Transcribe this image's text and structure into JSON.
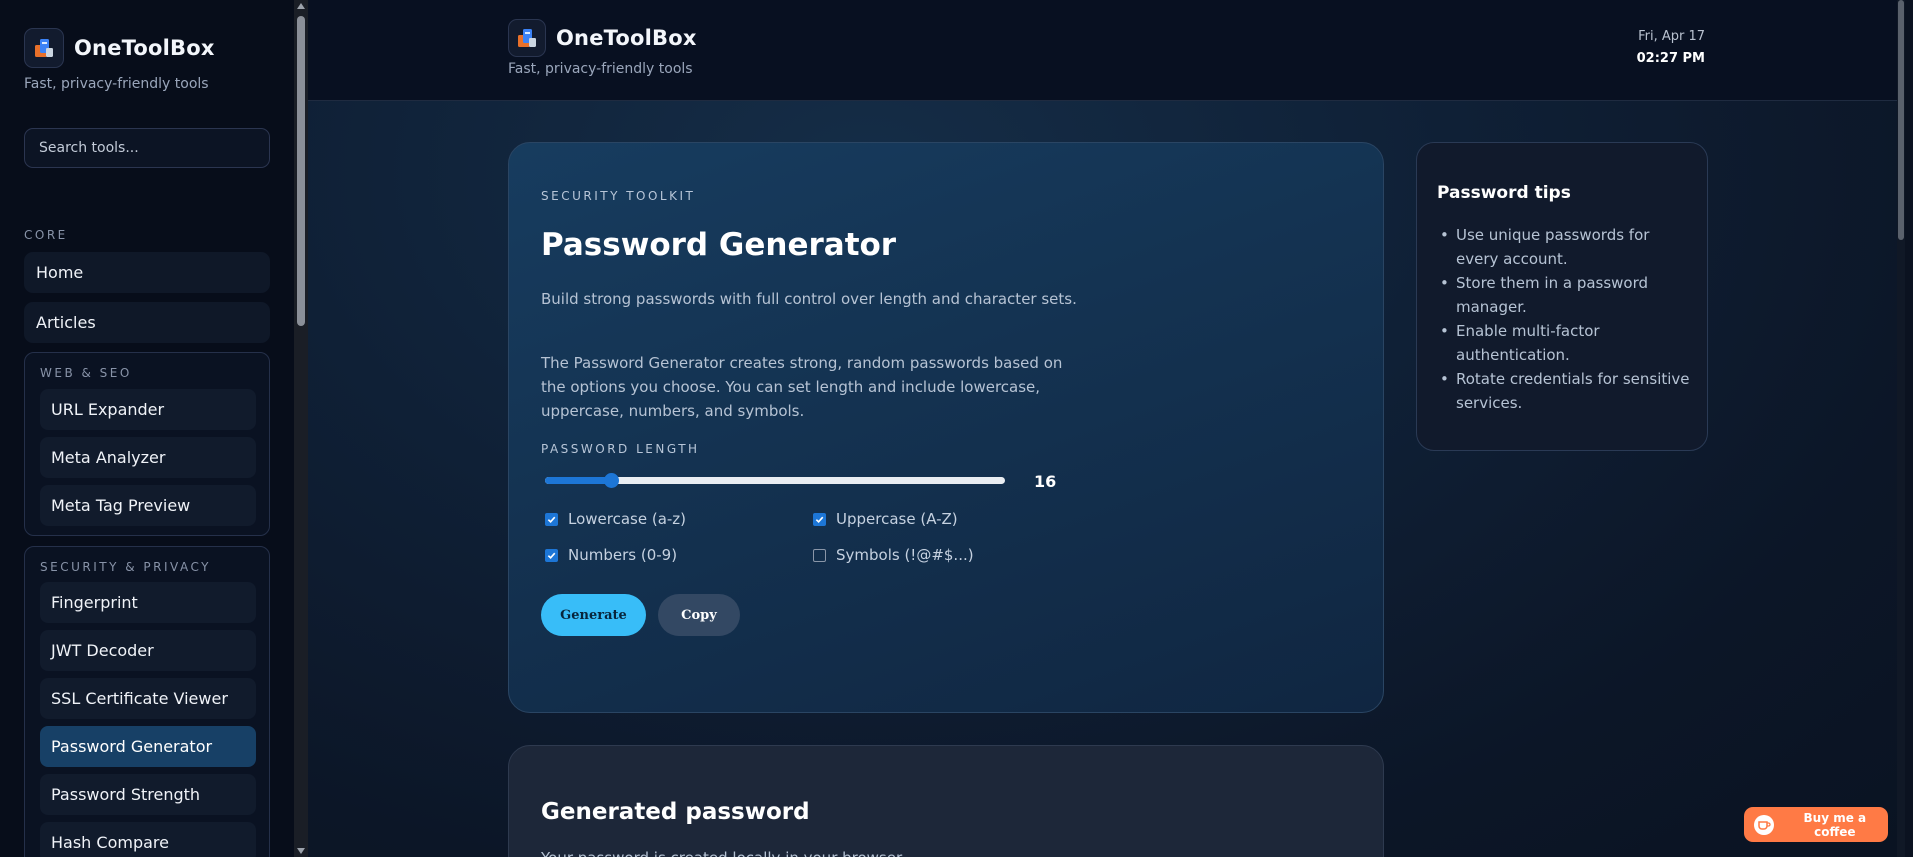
{
  "sidebar": {
    "brand": {
      "name": "OneToolBox",
      "tagline": "Fast, privacy-friendly tools"
    },
    "search": {
      "placeholder": "Search tools..."
    },
    "core": {
      "label": "CORE",
      "items": [
        "Home",
        "Articles"
      ]
    },
    "web_seo": {
      "label": "WEB & SEO",
      "items": [
        "URL Expander",
        "Meta Analyzer",
        "Meta Tag Preview"
      ]
    },
    "security": {
      "label": "SECURITY & PRIVACY",
      "items": [
        "Fingerprint",
        "JWT Decoder",
        "SSL Certificate Viewer",
        "Password Generator",
        "Password Strength",
        "Hash Compare"
      ],
      "active": "Password Generator"
    }
  },
  "header": {
    "brand": "OneToolBox",
    "tagline": "Fast, privacy-friendly tools",
    "date": "Fri, Apr 17",
    "time": "02:27 PM"
  },
  "generator": {
    "eyebrow": "SECURITY TOOLKIT",
    "title": "Password Generator",
    "description": "Build strong passwords with full control over length and character sets.",
    "details": "The Password Generator creates strong, random passwords based on the options you choose. You can set length and include lowercase, uppercase, numbers, and symbols.",
    "length_label": "PASSWORD LENGTH",
    "length": {
      "value": 16,
      "min": 8,
      "max": 64
    },
    "options": {
      "lowercase": {
        "label": "Lowercase (a-z)",
        "checked": true
      },
      "uppercase": {
        "label": "Uppercase (A-Z)",
        "checked": true
      },
      "numbers": {
        "label": "Numbers (0-9)",
        "checked": true
      },
      "symbols": {
        "label": "Symbols (!@#$...)",
        "checked": false
      }
    },
    "generate_label": "Generate",
    "copy_label": "Copy"
  },
  "tips": {
    "title": "Password tips",
    "items": [
      "Use unique passwords for every account.",
      "Store them in a password manager.",
      "Enable multi-factor authentication.",
      "Rotate credentials for sensitive services."
    ]
  },
  "output": {
    "title": "Generated password",
    "description": "Your password is created locally in your browser."
  },
  "coffee": {
    "label": "Buy me a coffee"
  },
  "colors": {
    "accent": "#38bdf8",
    "slider": "#1d76d6",
    "coffee": "#ff7a45",
    "active_nav": "#174066"
  }
}
